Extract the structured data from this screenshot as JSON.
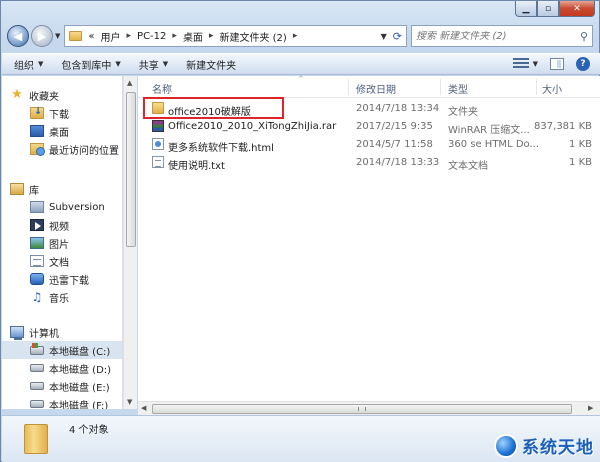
{
  "address_bar": {
    "overflow": "«",
    "crumbs": [
      "用户",
      "PC-12",
      "桌面",
      "新建文件夹 (2)"
    ]
  },
  "search": {
    "placeholder": "搜索 新建文件夹 (2)"
  },
  "toolbar": {
    "organize": "组织",
    "include_in_library": "包含到库中",
    "share": "共享",
    "new_folder": "新建文件夹"
  },
  "nav": {
    "favorites": {
      "label": "收藏夹",
      "items": [
        "下载",
        "桌面",
        "最近访问的位置"
      ]
    },
    "libraries": {
      "label": "库",
      "items": [
        "Subversion",
        "视频",
        "图片",
        "文档",
        "迅雷下载",
        "音乐"
      ]
    },
    "computer": {
      "label": "计算机",
      "items": [
        "本地磁盘 (C:)",
        "本地磁盘 (D:)",
        "本地磁盘 (E:)",
        "本地磁盘 (F:)"
      ],
      "selected_index": 0
    }
  },
  "columns": {
    "name": "名称",
    "modified": "修改日期",
    "type": "类型",
    "size": "大小"
  },
  "files": [
    {
      "name": "office2010破解版",
      "modified": "2014/7/18 13:34",
      "type": "文件夹",
      "size": "",
      "icon": "folder-icon",
      "highlighted": true
    },
    {
      "name": "Office2010_2010_XiTongZhiJia.rar",
      "modified": "2017/2/15 9:35",
      "type": "WinRAR 压缩文...",
      "size": "837,381 KB",
      "icon": "rar-icon",
      "highlighted": false
    },
    {
      "name": "更多系统软件下载.html",
      "modified": "2014/5/7 11:58",
      "type": "360 se HTML Do...",
      "size": "1 KB",
      "icon": "html-file-icon",
      "highlighted": false
    },
    {
      "name": "使用说明.txt",
      "modified": "2014/7/18 13:33",
      "type": "文本文档",
      "size": "1 KB",
      "icon": "txt-file-icon",
      "highlighted": false
    }
  ],
  "status": {
    "count": "4 个对象"
  },
  "watermark": {
    "text": "系统天地"
  },
  "colors": {
    "highlight": "#e0242a",
    "accent": "#2a62b8"
  }
}
